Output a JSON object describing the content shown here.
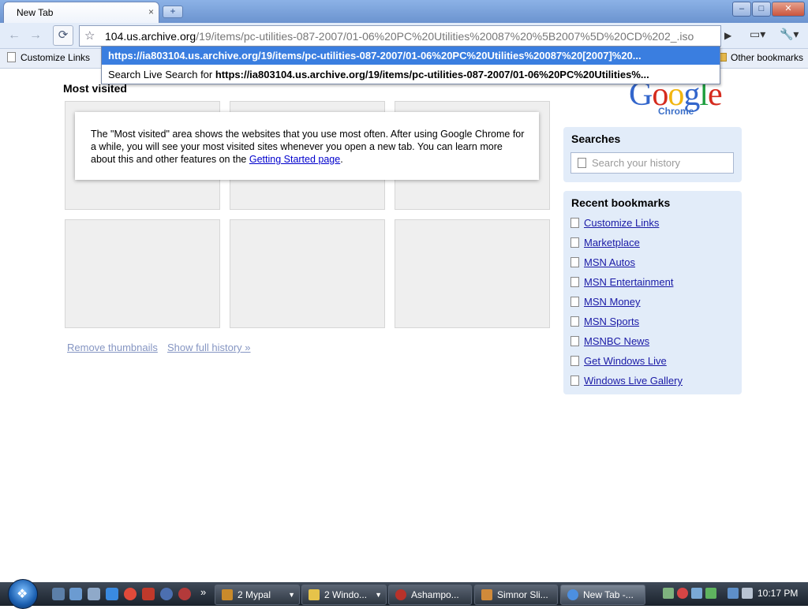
{
  "window": {
    "tab_title": "New Tab",
    "tab_close": "×",
    "new_tab": "+",
    "minimize": "–",
    "maximize": "□",
    "close": "✕"
  },
  "toolbar": {
    "back": "←",
    "forward": "→",
    "reload": "⟳",
    "star": "☆",
    "url_host": "104.us.archive.org",
    "url_path": "/19/items/pc-utilities-087-2007/01-06%20PC%20Utilities%20087%20%5B2007%5D%20CD%202_.iso",
    "go": "▶",
    "page_menu": "▭▾",
    "tools_menu": "🔧▾"
  },
  "bookmarks_bar": {
    "customize_links": "Customize Links",
    "other_bookmarks": "Other bookmarks"
  },
  "autocomplete": {
    "selected": "https://ia803104.us.archive.org/19/items/pc-utilities-087-2007/01-06%20PC%20Utilities%20087%20[2007]%20...",
    "search_prefix": "Search Live Search for",
    "search_query": "https://ia803104.us.archive.org/19/items/pc-utilities-087-2007/01-06%20PC%20Utilities%..."
  },
  "most_visited": {
    "heading": "Most visited",
    "info_text": "The \"Most visited\" area shows the websites that you use most often. After using Google Chrome for a while, you will see your most visited sites whenever you open a new tab. You can learn more about this and other features on the",
    "info_link": "Getting Started page",
    "info_end": ".",
    "remove_thumbnails": "Remove thumbnails",
    "show_full_history": "Show full history »"
  },
  "logo": {
    "word": "Google",
    "sub": "Chrome",
    "colors": [
      "#3366cc",
      "#d52b1e",
      "#f2b50f",
      "#3366cc",
      "#1e9e3e",
      "#d52b1e"
    ]
  },
  "searches": {
    "title": "Searches",
    "placeholder": "Search your history"
  },
  "recent_bookmarks": {
    "title": "Recent bookmarks",
    "items": [
      "Customize Links",
      "Marketplace",
      "MSN Autos",
      "MSN Entertainment",
      "MSN Money",
      "MSN Sports",
      "MSNBC News",
      "Get Windows Live",
      "Windows Live Gallery"
    ]
  },
  "taskbar": {
    "more": "»",
    "buttons": [
      {
        "label": "2 Mypal",
        "color": "#c98a2b"
      },
      {
        "label": "2 Windo...",
        "color": "#e6c34a"
      },
      {
        "label": "Ashampo...",
        "color": "#b8322a"
      },
      {
        "label": "Simnor Sli...",
        "color": "#d08a3a"
      },
      {
        "label": "New Tab -...",
        "color": "#4c8fe0"
      }
    ],
    "clock": "10:17 PM"
  }
}
